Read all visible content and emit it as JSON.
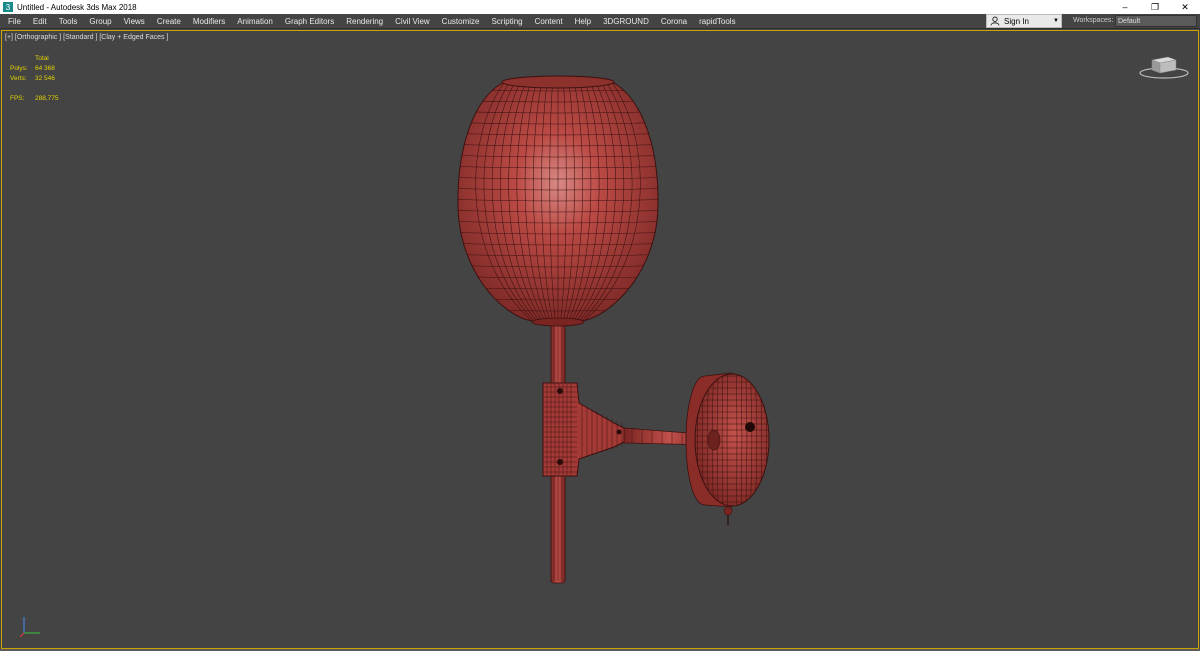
{
  "window": {
    "title": "Untitled - Autodesk 3ds Max 2018",
    "minimize": "–",
    "restore": "❐",
    "close": "✕"
  },
  "menu": [
    "File",
    "Edit",
    "Tools",
    "Group",
    "Views",
    "Create",
    "Modifiers",
    "Animation",
    "Graph Editors",
    "Rendering",
    "Civil View",
    "Customize",
    "Scripting",
    "Content",
    "Help",
    "3DGROUND",
    "Corona",
    "rapidTools"
  ],
  "account": {
    "signin_label": "Sign In"
  },
  "workspaces": {
    "label": "Workspaces:",
    "value": "Default"
  },
  "viewport": {
    "label": "[+] [Orthographic ] [Standard ] [Clay + Edged Faces ]",
    "stats": {
      "header": "Total",
      "polys_label": "Polys:",
      "polys_value": "64 368",
      "verts_label": "Verts:",
      "verts_value": "32 546",
      "fps_label": "FPS:",
      "fps_value": "288,775"
    }
  },
  "colors": {
    "model": "#b5433f",
    "viewport_bg": "#444444",
    "stats_text": "#e4d400",
    "active_border": "#c9a400"
  },
  "icons": [
    "app-icon",
    "user-icon",
    "viewcube-icon",
    "axis-tripod-icon"
  ]
}
